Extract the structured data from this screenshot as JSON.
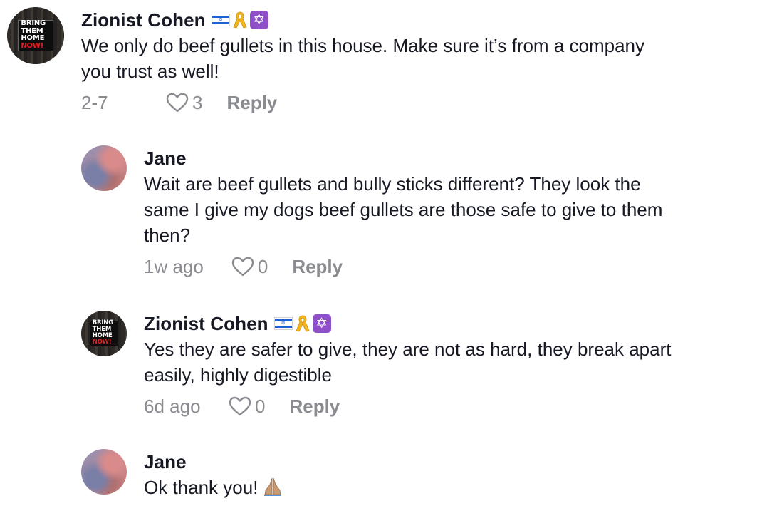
{
  "comments": [
    {
      "author": "Zionist Cohen",
      "text": "We only do beef gullets in this house. Make sure it’s from a company\nyou trust as well!",
      "time": "2-7",
      "likes": "3",
      "reply_label": "Reply",
      "avatar_text": [
        "BRING THEM",
        "HOME",
        "NOW!"
      ],
      "emojis": [
        "israel-flag-icon",
        "yellow-ribbon-icon",
        "star-of-david-icon"
      ]
    },
    {
      "author": "Jane",
      "text": "Wait are beef gullets and bully sticks different? They look the\nsame I give my dogs beef gullets are those safe to give to them\nthen?",
      "time": "1w ago",
      "likes": "0",
      "reply_label": "Reply"
    },
    {
      "author": "Zionist Cohen",
      "text": "Yes they are safer to give, they are not as hard, they break apart\neasily, highly digestible",
      "time": "6d ago",
      "likes": "0",
      "reply_label": "Reply",
      "avatar_text": [
        "BRING THEM",
        "HOME",
        "NOW!"
      ],
      "emojis": [
        "israel-flag-icon",
        "yellow-ribbon-icon",
        "star-of-david-icon"
      ]
    },
    {
      "author": "Jane",
      "text": "Ok thank you!",
      "emoji": "folded-hands-icon"
    }
  ],
  "colors": {
    "text": "#161823",
    "meta": "#8a8b91",
    "flag_blue": "#1f5fd1",
    "ribbon": "#f2b51d",
    "star_bg": "#8e4fc9"
  }
}
